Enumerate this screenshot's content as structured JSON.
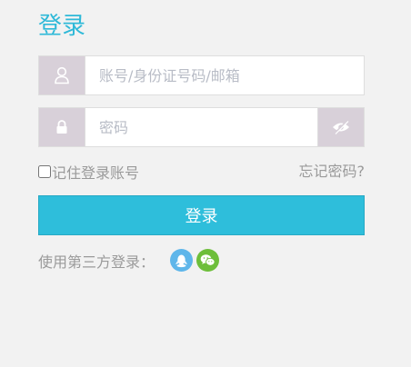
{
  "title": "登录",
  "username": {
    "placeholder": "账号/身份证号码/邮箱",
    "value": ""
  },
  "password": {
    "placeholder": "密码",
    "value": ""
  },
  "remember_label": "记住登录账号",
  "forgot_label": "忘记密码?",
  "login_button": "登录",
  "third_party_label": "使用第三方登录：",
  "colors": {
    "accent": "#2ebedb",
    "addon": "#d8d0d9",
    "qq": "#5eb6ea",
    "wechat": "#6dbe3a"
  },
  "icons": [
    "user-icon",
    "lock-icon",
    "eye-slash-icon",
    "qq-icon",
    "wechat-icon"
  ]
}
